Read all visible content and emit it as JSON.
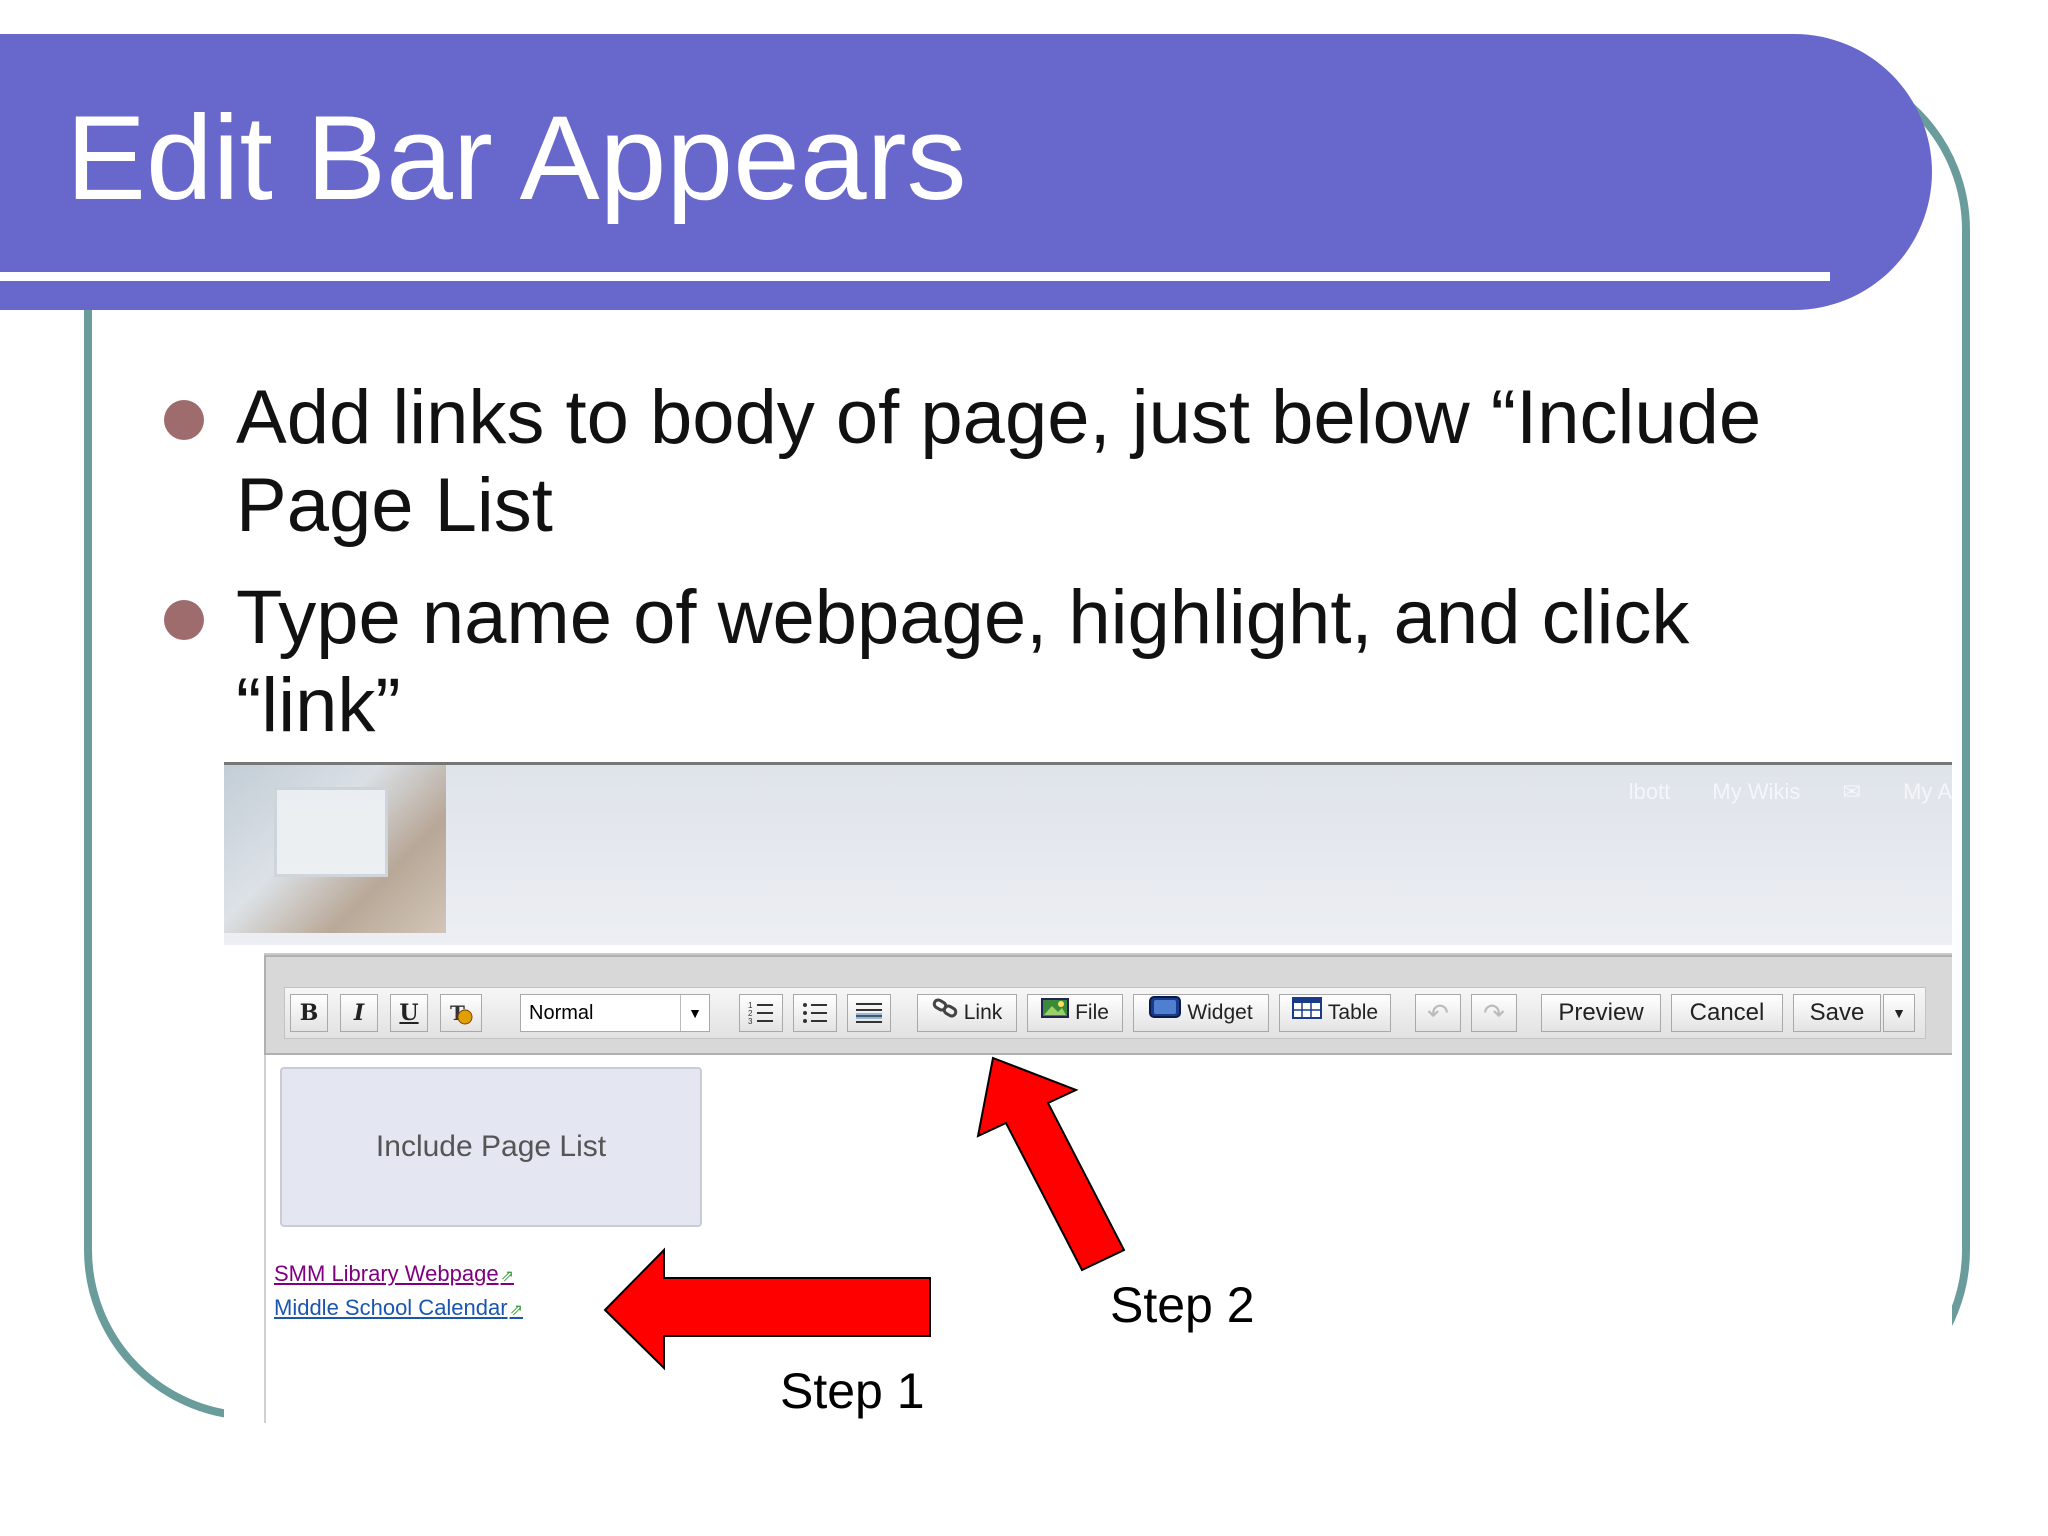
{
  "slide": {
    "title": "Edit Bar Appears",
    "bullets": [
      "Add links to body of page, just below “Include Page List",
      "Type name of webpage, highlight, and click “link”"
    ]
  },
  "screenshot": {
    "banner_nav": [
      "lbott",
      "My Wikis",
      "My A"
    ],
    "toolbar": {
      "bold": "B",
      "italic": "I",
      "underline": "U",
      "format_select": "Normal",
      "link": "Link",
      "file": "File",
      "widget": "Widget",
      "table": "Table",
      "preview": "Preview",
      "cancel": "Cancel",
      "save": "Save"
    },
    "include_page_list": "Include Page List",
    "links": [
      "SMM Library Webpage",
      "Middle School Calendar"
    ]
  },
  "annotations": {
    "step1": "Step 1",
    "step2": "Step 2",
    "arrow_color": "#ff0000"
  },
  "colors": {
    "title_bar": "#6868cc",
    "frame": "#6a9c9c",
    "bullet": "#9e6c6c",
    "link_visited": "#800080",
    "link": "#1a55b0"
  }
}
